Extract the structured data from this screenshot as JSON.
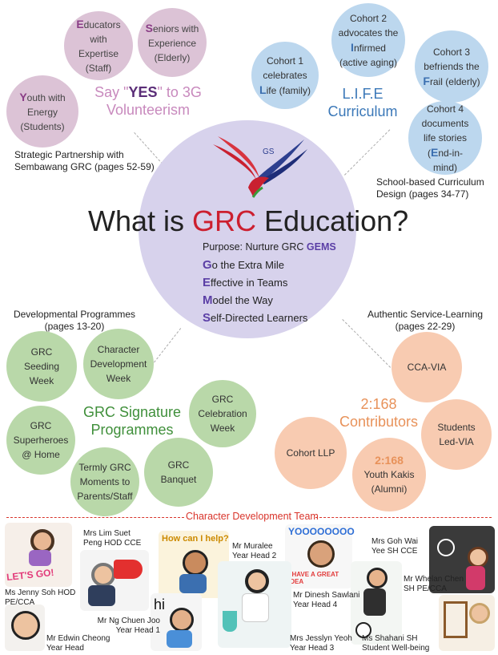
{
  "volunteers": {
    "educators": {
      "cap": "E",
      "rest": "ducators with Expertise (Staff)"
    },
    "seniors": {
      "cap": "S",
      "rest": "eniors with Experience (Elderly)"
    },
    "youth": {
      "cap": "Y",
      "rest": "outh with Energy (Students)"
    },
    "slogan_a": "Say \"",
    "slogan_yes": "YES",
    "slogan_b": "\" to 3G",
    "slogan_c": "Volunteerism",
    "partnership": "Strategic Partnership with Sembawang GRC (pages 52-59)"
  },
  "life": {
    "cohort1": {
      "pre": "Cohort 1 celebrates ",
      "cap": "L",
      "post": "ife (family)"
    },
    "cohort2": {
      "pre": "Cohort 2 advocates the ",
      "cap": "I",
      "post": "nfirmed (active aging)"
    },
    "cohort3": {
      "pre": "Cohort 3 befriends the ",
      "cap": "F",
      "post": "rail (elderly)"
    },
    "cohort4": {
      "pre": "Cohort 4 documents life stories (",
      "cap": "E",
      "post": "nd-in-mind)"
    },
    "title_a": "L.I.F.E",
    "title_b": "Curriculum",
    "design": "School-based Curriculum Design (pages 34-77)"
  },
  "centre": {
    "title_a": "What is ",
    "title_grc": "GRC",
    "title_b": " Education?",
    "purpose": "Purpose: Nurture GRC ",
    "gems": "GEMS",
    "g_cap": "G",
    "g_rest": "o the Extra Mile",
    "e_cap": "E",
    "e_rest": "ffective in Teams",
    "m_cap": "M",
    "m_rest": "odel the Way",
    "s_cap": "S",
    "s_rest": "elf-Directed Learners"
  },
  "developmental": {
    "label": "Developmental Programmes (pages 13-20)",
    "seeding": "GRC Seeding Week",
    "character": "Character Development Week",
    "celebration": "GRC Celebration Week",
    "superheroes": "GRC Superheroes @ Home",
    "termly": "Termly GRC Moments to Parents/Staff",
    "banquet": "GRC Banquet",
    "sig_a": "GRC Signature",
    "sig_b": "Programmes"
  },
  "service": {
    "label": "Authentic Service-Learning (pages 22-29)",
    "cca": "CCA-VIA",
    "students": "Students Led-VIA",
    "llp": "Cohort LLP",
    "kakis_num": "2:168",
    "kakis_txt": "Youth Kakis (Alumni)",
    "contrib_a": "2:168",
    "contrib_b": "Contributors"
  },
  "team": {
    "title": "Character Development Team",
    "soh": "Ms Jenny Soh HOD PE/CCA",
    "lim": "Mrs Lim Suet Peng HOD CCE",
    "muralee": "Mr Muralee Year Head 2",
    "ng": "Mr Ng Chuen Joo Year Head 1",
    "cheong": "Mr Edwin Cheong Year Head",
    "sawlani": "Mr Dinesh Sawlani Year Head 4",
    "goh": "Mrs Goh Wai Yee SH CCE",
    "chen": "Mr Whelan Chen SH PE/CCA",
    "yeoh": "Mrs Jesslyn Yeoh Year Head 3",
    "shahani": "Ms Shahani SH Student Well-being",
    "sticker_lets_go": "LET'S GO!",
    "sticker_help": "How can I help?",
    "sticker_yoo": "YOOOOOOOO",
    "sticker_idea": "I HAVE A GREAT IDEA",
    "sticker_hi": "hi"
  },
  "colors": {
    "grc_red": "#cc1f2f",
    "gems_purple": "#5b3fa6",
    "signature_green": "#3f8f3a",
    "contrib_orange": "#e8925a",
    "team_red": "#d9342b"
  }
}
